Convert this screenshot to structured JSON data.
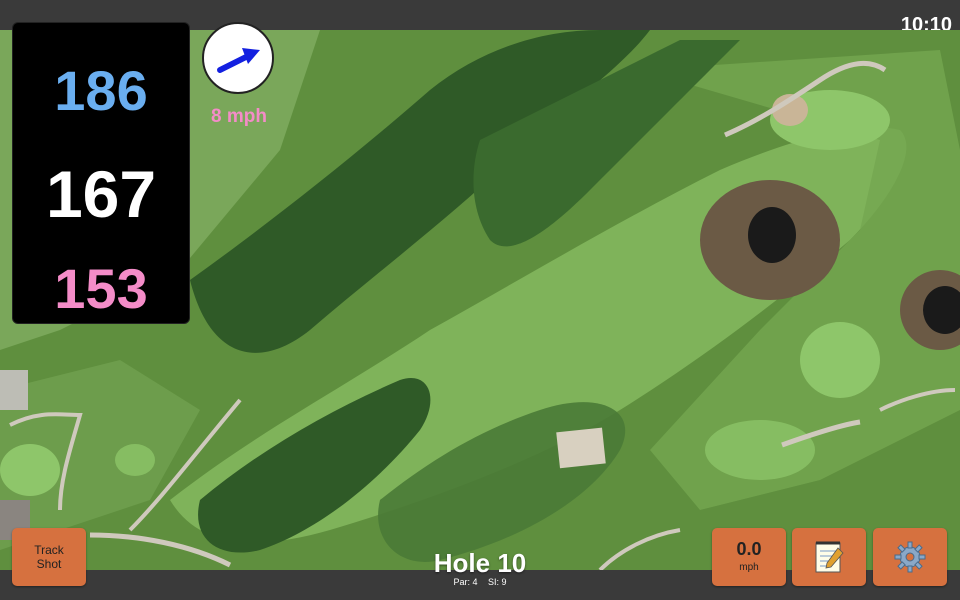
{
  "status_bar": {
    "time": "10:10"
  },
  "distances": {
    "back": "186",
    "middle": "167",
    "front": "153",
    "colors": {
      "back": "#6aaef0",
      "middle": "#ffffff",
      "front": "#f48cc8"
    }
  },
  "wind": {
    "speed_label": "8 mph",
    "direction_icon": "arrow-right-up-icon",
    "arrow_color": "#1320e0",
    "label_color": "#f48cc8"
  },
  "buttons": {
    "track_shot": {
      "line1": "Track",
      "line2": "Shot"
    },
    "speed": {
      "value": "0.0",
      "unit": "mph"
    },
    "notes": {
      "icon": "notepad-icon"
    },
    "settings": {
      "icon": "gear-icon"
    },
    "color": "#d6713f"
  },
  "hole": {
    "title": "Hole 10",
    "par": "Par: 4",
    "stroke_index": "SI: 9"
  }
}
